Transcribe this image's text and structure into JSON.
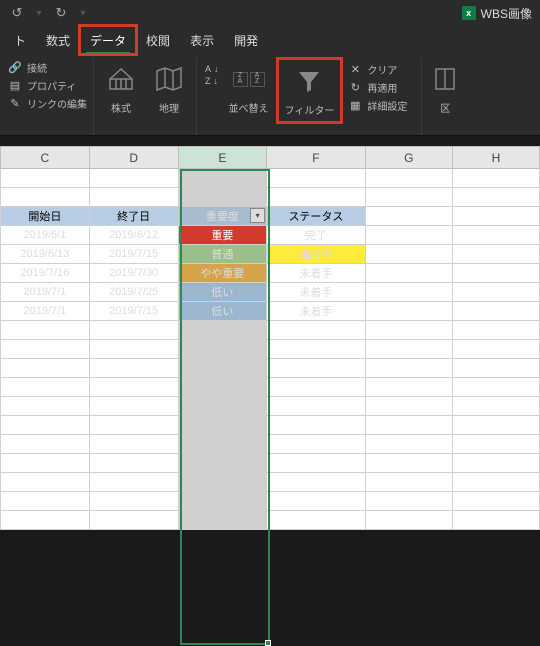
{
  "titlebar": {
    "doc_name": "WBS画像"
  },
  "tabs": {
    "t0": "ト",
    "t1": "数式",
    "t2": "データ",
    "t3": "校閲",
    "t4": "表示",
    "t5": "開発"
  },
  "ribbon": {
    "connect": "接続",
    "property": "プロパティ",
    "editlinks": "リンクの編集",
    "stocks": "株式",
    "geo": "地理",
    "sort": "並べ替え",
    "filter": "フィルター",
    "clear": "クリア",
    "reapply": "再適用",
    "advanced": "詳細設定",
    "split": "区"
  },
  "columns": {
    "C": "C",
    "D": "D",
    "E": "E",
    "F": "F",
    "G": "G",
    "H": "H"
  },
  "headers": {
    "start": "開始日",
    "end": "終了日",
    "priority": "重要度",
    "status": "ステータス"
  },
  "rows": [
    {
      "start": "2019/6/1",
      "end": "2019/6/12",
      "priority": "重要",
      "pclass": "c-red",
      "status": "完了",
      "sclass": ""
    },
    {
      "start": "2019/6/13",
      "end": "2019/7/15",
      "priority": "普通",
      "pclass": "c-green",
      "status": "進行中",
      "sclass": "c-yellow"
    },
    {
      "start": "2019/7/16",
      "end": "2019/7/30",
      "priority": "やや重要",
      "pclass": "c-orange",
      "status": "未着手",
      "sclass": ""
    },
    {
      "start": "2019/7/1",
      "end": "2019/7/25",
      "priority": "低い",
      "pclass": "c-blue",
      "status": "未着手",
      "sclass": ""
    },
    {
      "start": "2019/7/1",
      "end": "2019/7/15",
      "priority": "低い",
      "pclass": "c-blue",
      "status": "未着手",
      "sclass": ""
    }
  ]
}
